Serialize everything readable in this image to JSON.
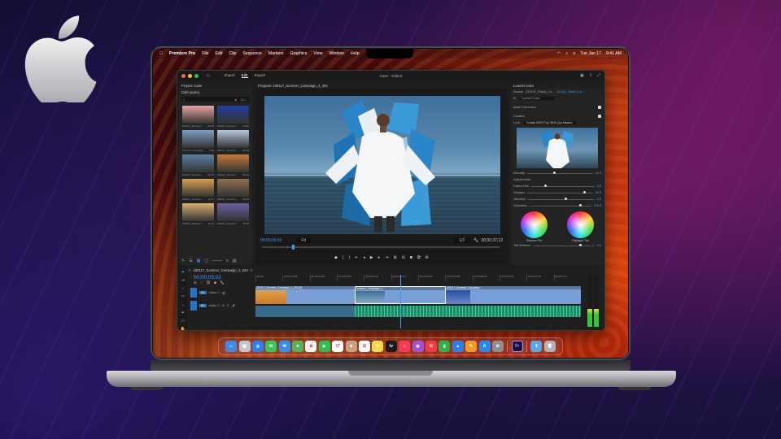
{
  "menubar": {
    "app_name": "Premiere Pro",
    "items": [
      "File",
      "Edit",
      "Clip",
      "Sequence",
      "Markers",
      "Graphics",
      "View",
      "Window",
      "Help"
    ],
    "date": "Tue Jan 17",
    "time": "9:41 AM"
  },
  "window": {
    "title": "Calm - Edited",
    "tabs": [
      "Import",
      "Edit",
      "Export"
    ],
    "active_tab": "Edit"
  },
  "project": {
    "header": "Project: Calm",
    "file": "Calm.prproj",
    "count": "13 I...",
    "thumbs": [
      {
        "caption": "230117_Summer...",
        "duration": "05:18",
        "color": "#e9a3a0"
      },
      {
        "caption": "230117_Summer...",
        "duration": "04:20",
        "color": "#1f3f9a"
      },
      {
        "caption": "Summer_Campaig...",
        "duration": "6:09",
        "color": "#7f9fc4"
      },
      {
        "caption": "230117_Summer...",
        "duration": "05:18",
        "color": "#b5c7de"
      },
      {
        "caption": "230117_Summer...",
        "duration": "05:18",
        "color": "#5b7fa3"
      },
      {
        "caption": "230117_Summer...",
        "duration": "05:18",
        "color": "#c77a3a"
      },
      {
        "caption": "230117_Summer...",
        "duration": "16:11",
        "color": "#d9a050"
      },
      {
        "caption": "230117_Summer...",
        "duration": "05:18",
        "color": "#8f7050"
      },
      {
        "caption": "230117_Summer...",
        "duration": "14:16",
        "color": "#d8b070"
      },
      {
        "caption": "230117_Summer...",
        "duration": "05:18",
        "color": "#6b5fa0"
      }
    ]
  },
  "program": {
    "header": "Program: 230117_Summer_Campaign_3_333",
    "timecode_in": "00;00;05;02",
    "fit": "Fit",
    "quality": "1/2",
    "timecode_out": "00;00;37;13"
  },
  "lumetri": {
    "header": "Lumetri Color",
    "source": "Source - 221101_Rollo1_Lit...",
    "clip": "221101_Rollo1_Lit...",
    "effect": "Lumetri Color",
    "basic": "Basic Correction",
    "creative": "Creative",
    "look_label": "Look",
    "look_value": "Kodak 5300 Fuji 3510 (by Adobe)",
    "intensity_label": "Intensity",
    "intensity": "43.3",
    "adjustments": "Adjustments",
    "sliders": [
      {
        "label": "Faded Film",
        "value": "0.0",
        "level": 0.2
      },
      {
        "label": "Sharpen",
        "value": "30.0",
        "level": 0.85
      },
      {
        "label": "Vibrance",
        "value": "0.0",
        "level": 0.55
      },
      {
        "label": "Saturation",
        "value": "113.3",
        "level": 0.8
      }
    ],
    "shadow_tint": "Shadow Tint",
    "highlight_tint": "Highlight Tint",
    "tint_balance": "Tint Balance",
    "tint_balance_value": "0.0"
  },
  "timeline": {
    "sequence": "230117_Summer_Campaign_3_333",
    "timecode": "00;00;05;02",
    "ruler": [
      "00;00",
      "00;00;01;00",
      "00;00;02;00",
      "00;00;03;00",
      "00;00;04;00",
      "00;00;05;00",
      "00;00;06;00",
      "00;00;07;00",
      "00;00;08;00",
      "00;00;09;00",
      "00;00;10;00",
      "00;00;11;0"
    ],
    "tracks": [
      {
        "name": "V1",
        "label": "Video 1"
      },
      {
        "name": "A1",
        "label": "Audio 1"
      }
    ],
    "clips": [
      {
        "label": "230117_Summer_Campaign_3_333 [V]",
        "color": "#7a9fd4"
      },
      {
        "label": "Summer_Campaign_3",
        "color": "#7a9fd4"
      },
      {
        "label": "230117_Summer_Campaign...",
        "color": "#7a9fd4"
      }
    ]
  },
  "dock": {
    "apps": [
      {
        "name": "finder-icon",
        "color": "#3b8be8",
        "glyph": "☺"
      },
      {
        "name": "launchpad-icon",
        "color": "#c4c4d0",
        "glyph": "▦"
      },
      {
        "name": "safari-icon",
        "color": "#2a7ef0",
        "glyph": "◎"
      },
      {
        "name": "messages-icon",
        "color": "#35c759",
        "glyph": "✉"
      },
      {
        "name": "mail-icon",
        "color": "#2f8fff",
        "glyph": "✉"
      },
      {
        "name": "maps-icon",
        "color": "#58b35a",
        "glyph": "➤"
      },
      {
        "name": "photos-icon",
        "color": "#f4f4f4",
        "glyph": "✿"
      },
      {
        "name": "facetime-icon",
        "color": "#2fbf4e",
        "glyph": "▶"
      },
      {
        "name": "calendar-icon",
        "color": "#ffffff",
        "glyph": "17"
      },
      {
        "name": "contacts-icon",
        "color": "#c7a27a",
        "glyph": "☻"
      },
      {
        "name": "reminders-icon",
        "color": "#ffffff",
        "glyph": "☰"
      },
      {
        "name": "notes-icon",
        "color": "#f7d94a",
        "glyph": "✎"
      },
      {
        "name": "tv-icon",
        "color": "#1a1a1a",
        "glyph": "tv"
      },
      {
        "name": "music-icon",
        "color": "#fa3a55",
        "glyph": "♫"
      },
      {
        "name": "podcasts-icon",
        "color": "#a24ee0",
        "glyph": "◉"
      },
      {
        "name": "news-icon",
        "color": "#f23a48",
        "glyph": "N"
      },
      {
        "name": "numbers-icon",
        "color": "#2bb34a",
        "glyph": "▮"
      },
      {
        "name": "keynote-icon",
        "color": "#2a7ef0",
        "glyph": "▲"
      },
      {
        "name": "pages-icon",
        "color": "#f49a2a",
        "glyph": "✎"
      },
      {
        "name": "app-store-icon",
        "color": "#1e8ef5",
        "glyph": "A"
      },
      {
        "name": "system-settings-icon",
        "color": "#8e8e93",
        "glyph": "⚙"
      },
      {
        "name": "premiere-pro-icon",
        "color": "#1f0f3f",
        "glyph": "Pr"
      },
      {
        "name": "downloads-folder-icon",
        "color": "#5aa8e8",
        "glyph": "⬇"
      },
      {
        "name": "trash-icon",
        "color": "#b0b0b8",
        "glyph": "🗑"
      }
    ]
  }
}
